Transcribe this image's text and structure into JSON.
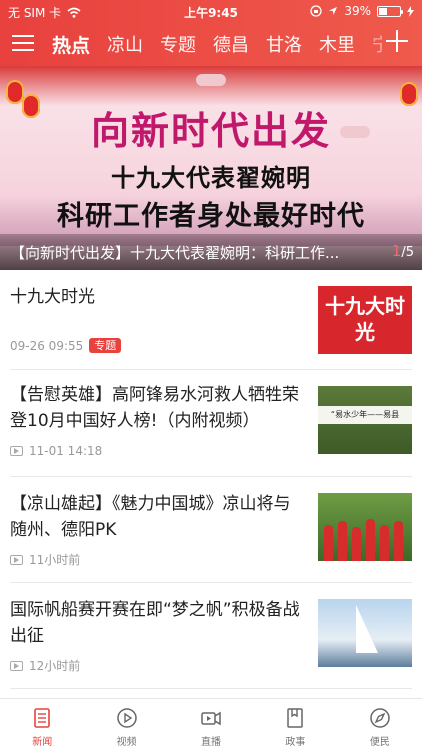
{
  "status_bar": {
    "carrier": "无 SIM 卡",
    "time": "上午9:45",
    "battery": "39%"
  },
  "nav": {
    "tabs": [
      "热点",
      "凉山",
      "专题",
      "德昌",
      "甘洛",
      "木里",
      "宁"
    ],
    "active_index": 0
  },
  "banner": {
    "title": "向新时代出发",
    "headline_line1": "十九大代表翟婉明",
    "headline_line2": "科研工作者身处最好时代",
    "caption": "【向新时代出发】十九大代表翟婉明：科研工作...",
    "page_current": "1",
    "page_total": "/5"
  },
  "news": [
    {
      "title": "十九大时光",
      "time": "09-26 09:55",
      "tag": "专题",
      "thumb_text": "十九大时光",
      "has_video": false
    },
    {
      "title": "【告慰英雄】高阿锋易水河救人牺牲荣登10月中国好人榜!（内附视频）",
      "time": "11-01 14:18",
      "thumb_text": "“易水少年——易县",
      "has_video": true
    },
    {
      "title": "【凉山雄起】《魅力中国城》凉山将与随州、德阳PK",
      "time": "11小时前",
      "has_video": true
    },
    {
      "title": "国际帆船赛开赛在即“梦之帆”积极备战出征",
      "time": "12小时前",
      "has_video": true
    }
  ],
  "bottom_tabs": [
    {
      "label": "新闻",
      "icon": "news-icon"
    },
    {
      "label": "视频",
      "icon": "play-icon"
    },
    {
      "label": "直播",
      "icon": "camera-icon"
    },
    {
      "label": "政事",
      "icon": "book-icon"
    },
    {
      "label": "便民",
      "icon": "compass-icon"
    }
  ],
  "colors": {
    "accent": "#e8413e",
    "text": "#222222",
    "meta": "#999999"
  }
}
